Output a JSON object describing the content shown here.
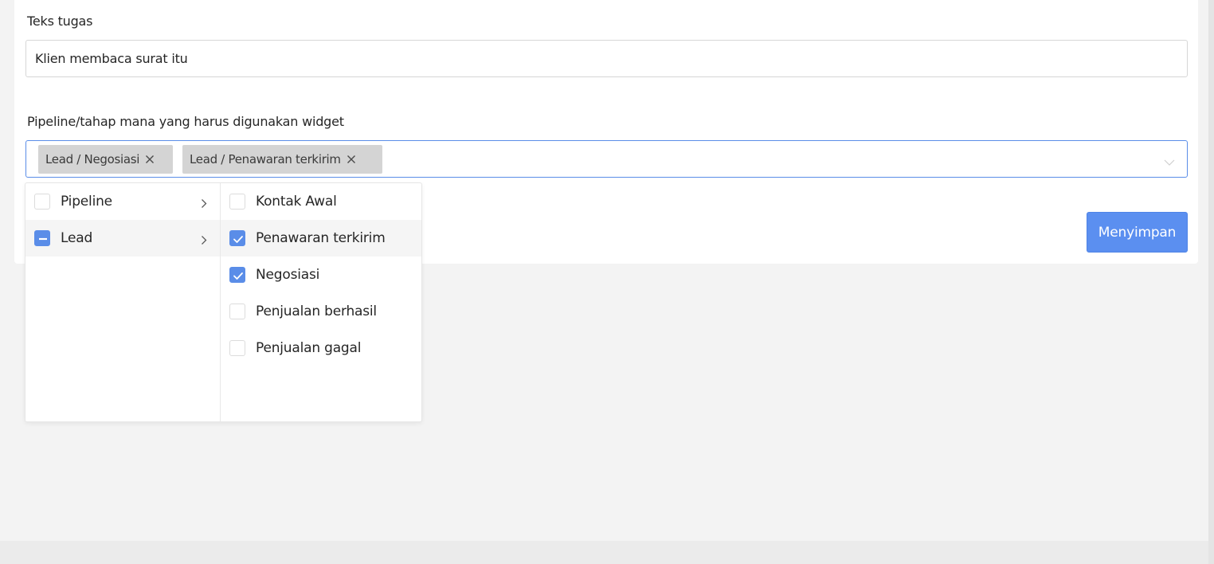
{
  "task_text": {
    "label": "Teks tugas",
    "value": "Klien membaca surat itu"
  },
  "pipeline_select": {
    "label": "Pipeline/tahap mana yang harus digunakan widget",
    "selected_tags": [
      {
        "label": "Lead / Negosiasi"
      },
      {
        "label": "Lead / Penawaran terkirim"
      }
    ],
    "expand_icon": "chevron-down-icon"
  },
  "dropdown": {
    "pipelines": [
      {
        "label": "Pipeline",
        "state": "unchecked",
        "icon": "chevron-right-icon"
      },
      {
        "label": "Lead",
        "state": "indeterminate",
        "icon": "chevron-right-icon",
        "active": true
      }
    ],
    "stages": [
      {
        "label": "Kontak Awal",
        "checked": false
      },
      {
        "label": "Penawaran terkirim",
        "checked": true,
        "active": true
      },
      {
        "label": "Negosiasi",
        "checked": true
      },
      {
        "label": "Penjualan berhasil",
        "checked": false
      },
      {
        "label": "Penjualan gagal",
        "checked": false
      }
    ]
  },
  "actions": {
    "save_label": "Menyimpan"
  },
  "colors": {
    "accent": "#5b8ff0",
    "focus_border": "#5a8de8",
    "tag_bg": "#d4d4d4",
    "page_bg": "#f3f3f3"
  }
}
